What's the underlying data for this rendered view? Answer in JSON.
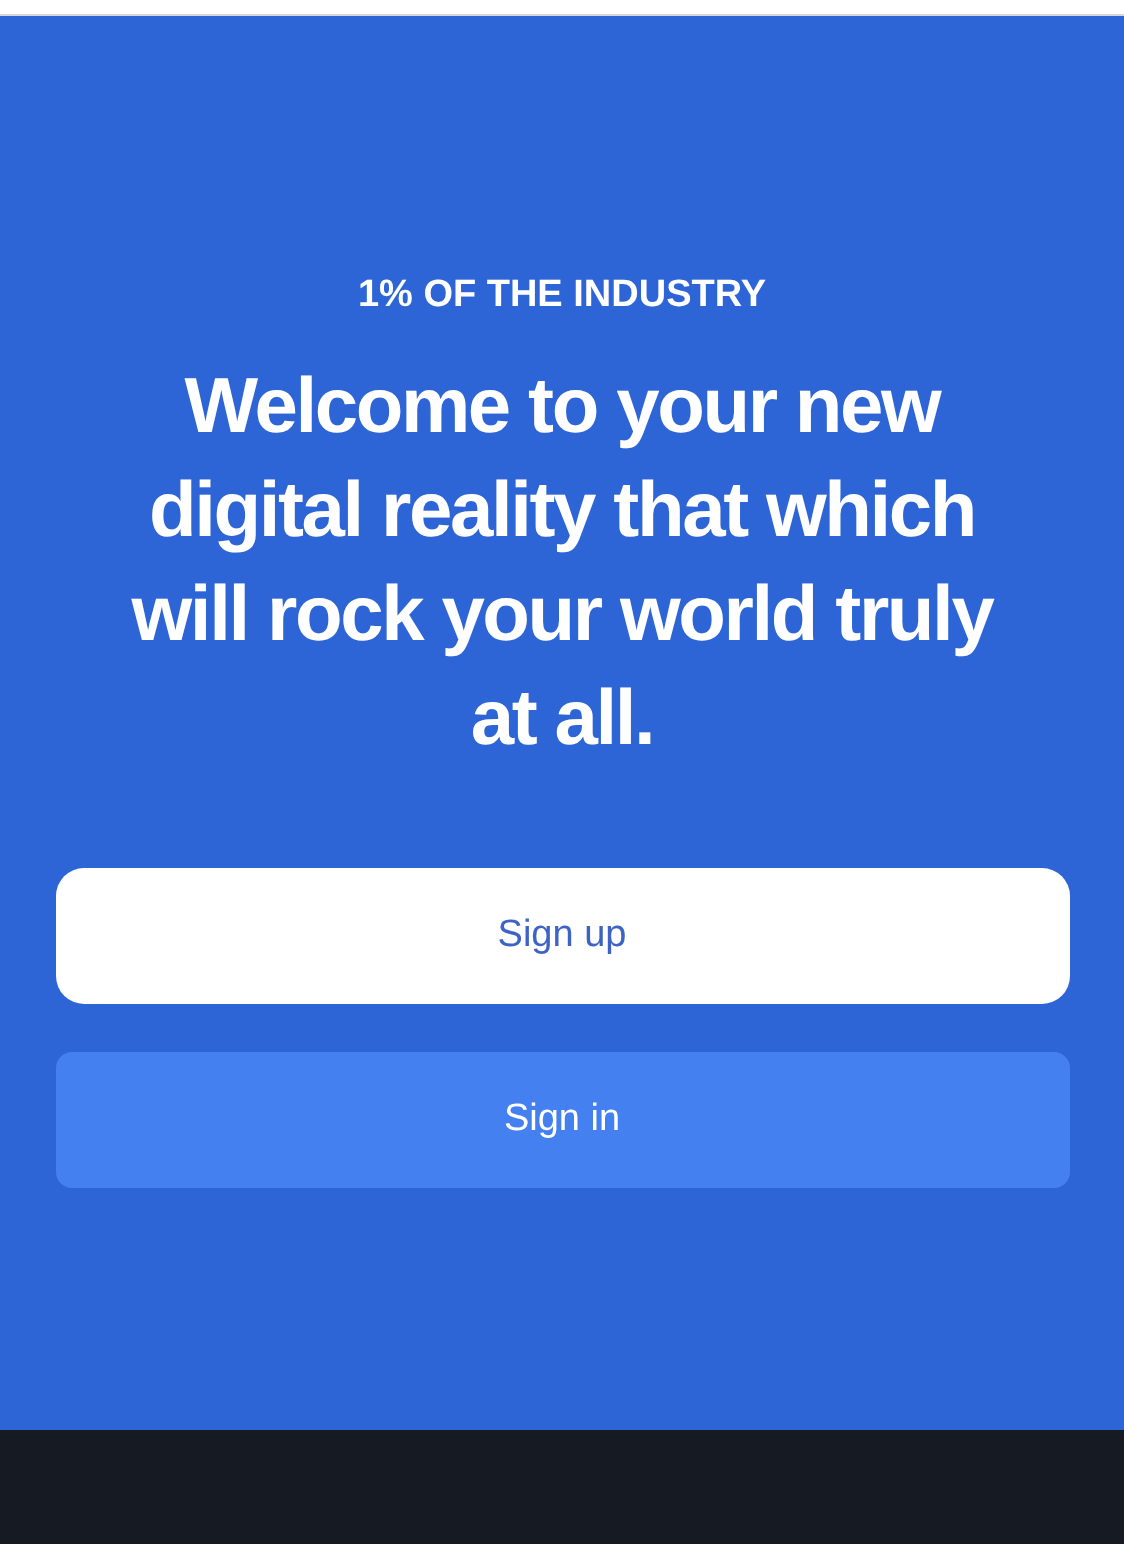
{
  "eyebrow": "1% OF THE INDUSTRY",
  "headline": "Welcome to your new digital reality that which will rock your world truly at all.",
  "buttons": [
    {
      "label": "Sign up",
      "kind": "light"
    },
    {
      "label": "Sign in",
      "kind": "tinted"
    }
  ]
}
